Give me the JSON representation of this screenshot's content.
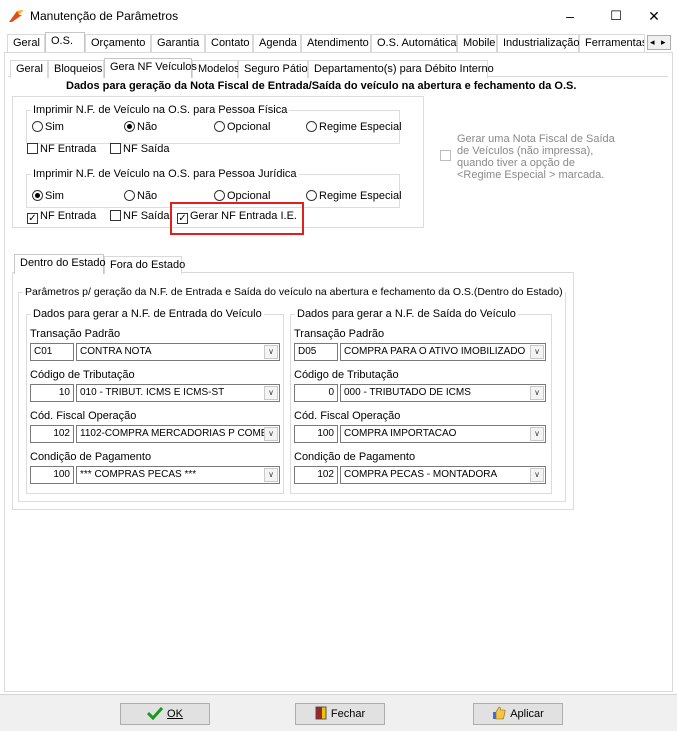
{
  "window": {
    "title": "Manutenção de Parâmetros",
    "minimize": "–",
    "maximize": "☐",
    "close": "✕"
  },
  "top_tabs": [
    "Geral",
    "O.S.",
    "Orçamento",
    "Garantia",
    "Contato",
    "Agenda",
    "Atendimento",
    "O.S. Automática",
    "Mobile",
    "Industrialização",
    "Ferramentas"
  ],
  "top_tabs_active": "O.S.",
  "scroll_left": "◂",
  "scroll_right": "▸",
  "sub_tabs": [
    "Geral",
    "Bloqueios",
    "Gera NF Veículos",
    "Modelos",
    "Seguro Pátio",
    "Departamento(s) para Débito Interno"
  ],
  "sub_tabs_active": "Gera NF Veículos",
  "section_title": "Dados para geração da Nota Fiscal de Entrada/Saída do veículo na abertura e fechamento da O.S.",
  "pf": {
    "legend": "Imprimir N.F. de Veículo na O.S. para Pessoa Física",
    "options": [
      "Sim",
      "Não",
      "Opcional",
      "Regime Especial"
    ],
    "selected": "Não",
    "nf_entrada": "NF Entrada",
    "nf_saida": "NF Saída"
  },
  "pj": {
    "legend": "Imprimir N.F. de Veículo na O.S. para Pessoa Jurídica",
    "options": [
      "Sim",
      "Não",
      "Opcional",
      "Regime Especial"
    ],
    "selected": "Sim",
    "nf_entrada": "NF Entrada",
    "nf_entrada_checked": true,
    "nf_saida": "NF Saída",
    "gerar_ie": "Gerar NF Entrada I.E.",
    "gerar_ie_checked": true
  },
  "side_note": {
    "line1": "Gerar uma Nota Fiscal de Saída",
    "line2": "de Veículos (não impressa),",
    "line3": "quando tiver a opção de",
    "line4": "<Regime Especial > marcada."
  },
  "state_tabs": [
    "Dentro do Estado",
    "Fora do Estado"
  ],
  "state_tabs_active": "Dentro do Estado",
  "params_legend": "Parâmetros p/ geração da N.F. de Entrada e Saída do veículo na abertura e fechamento da O.S.(Dentro do Estado)",
  "entrada": {
    "legend": "Dados para gerar a N.F. de Entrada do Veículo",
    "transacao_label": "Transação Padrão",
    "transacao_code": "C01",
    "transacao_desc": "CONTRA NOTA",
    "tributacao_label": "Código de Tributação",
    "tributacao_code": "10",
    "tributacao_desc": "010 - TRIBUT. ICMS E ICMS-ST",
    "cfop_label": "Cód. Fiscal Operação",
    "cfop_code": "102",
    "cfop_desc": "1102-COMPRA MERCADORIAS P COMER",
    "pagamento_label": "Condição de Pagamento",
    "pagamento_code": "100",
    "pagamento_desc": "*** COMPRAS PECAS ***"
  },
  "saida": {
    "legend": "Dados para gerar a N.F. de Saída do Veículo",
    "transacao_label": "Transação Padrão",
    "transacao_code": "D05",
    "transacao_desc": "COMPRA PARA O ATIVO IMOBILIZADO",
    "tributacao_label": "Código de Tributação",
    "tributacao_code": "0",
    "tributacao_desc": "000 - TRIBUTADO DE ICMS",
    "cfop_label": "Cód. Fiscal Operação",
    "cfop_code": "100",
    "cfop_desc": "COMPRA IMPORTACAO",
    "pagamento_label": "Condição de Pagamento",
    "pagamento_code": "102",
    "pagamento_desc": "COMPRA PECAS - MONTADORA"
  },
  "buttons": {
    "ok": "OK",
    "fechar": "Fechar",
    "aplicar": "Aplicar"
  },
  "colors": {
    "highlight": "#e0201e",
    "check_green": "#1a9a1a"
  }
}
